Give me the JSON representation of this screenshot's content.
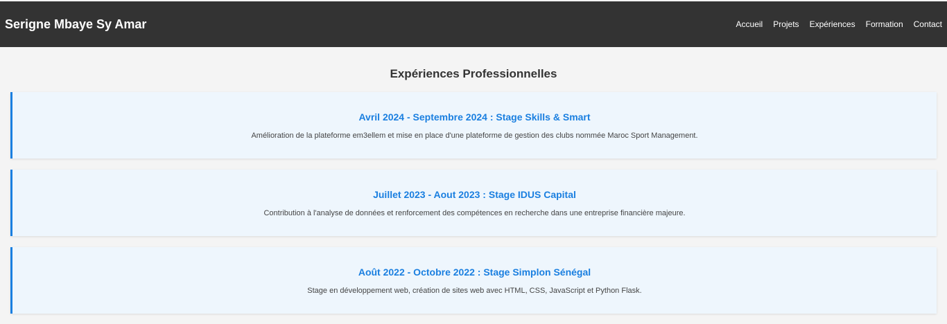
{
  "header": {
    "brand": "Serigne Mbaye Sy Amar",
    "nav": [
      {
        "label": "Accueil"
      },
      {
        "label": "Projets"
      },
      {
        "label": "Expériences"
      },
      {
        "label": "Formation"
      },
      {
        "label": "Contact"
      }
    ]
  },
  "main": {
    "section_title": "Expériences Professionnelles",
    "experiences": [
      {
        "title": "Avril 2024 - Septembre 2024 : Stage Skills & Smart",
        "description": "Amélioration de la plateforme em3ellem et mise en place d'une plateforme de gestion des clubs nommée Maroc Sport Management."
      },
      {
        "title": "Juillet 2023 - Aout 2023 : Stage IDUS Capital",
        "description": "Contribution à l'analyse de données et renforcement des compétences en recherche dans une entreprise financière majeure."
      },
      {
        "title": "Août 2022 - Octobre 2022 : Stage Simplon Sénégal",
        "description": "Stage en développement web, création de sites web avec HTML, CSS, JavaScript et Python Flask."
      }
    ]
  },
  "colors": {
    "navbar_bg": "#333333",
    "page_bg": "#f4f4f4",
    "accent": "#1a7fe0",
    "card_bg": "#eef6fd"
  }
}
